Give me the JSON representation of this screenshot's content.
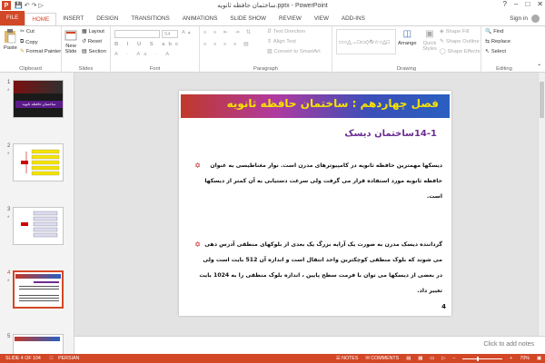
{
  "window": {
    "title": "ساختمان حافظه ثانویه.pptx - PowerPoint",
    "app_icon": "P",
    "minimize": "–",
    "maximize": "□",
    "close": "✕",
    "help": "?"
  },
  "quick_access": [
    "save-icon",
    "undo-icon",
    "redo-icon",
    "start-icon"
  ],
  "tabs": [
    "FILE",
    "HOME",
    "INSERT",
    "DESIGN",
    "TRANSITIONS",
    "ANIMATIONS",
    "SLIDE SHOW",
    "REVIEW",
    "VIEW",
    "ADD-INS"
  ],
  "active_tab": "HOME",
  "signin": "Sign in",
  "ribbon": {
    "clipboard": {
      "label": "Clipboard",
      "paste": "Paste",
      "cut": "Cut",
      "copy": "Copy",
      "format_painter": "Format Painter"
    },
    "slides": {
      "label": "Slides",
      "new_slide": "New",
      "new_slide2": "Slide",
      "layout": "Layout",
      "reset": "Reset",
      "section": "Section"
    },
    "font": {
      "label": "Font",
      "font_size": "54"
    },
    "paragraph": {
      "label": "Paragraph",
      "text_direction": "Text Direction",
      "align_text": "Align Text",
      "convert": "Convert to SmartArt"
    },
    "drawing": {
      "label": "Drawing",
      "arrange": "Arrange",
      "quick_styles": "Quick Styles",
      "shape_fill": "Shape Fill",
      "shape_outline": "Shape Outline",
      "shape_effects": "Shape Effects"
    },
    "editing": {
      "label": "Editing",
      "find": "Find",
      "replace": "Replace",
      "select": "Select"
    }
  },
  "thumbnails": [
    {
      "num": "1",
      "title": "ساختمان حافظه ثانویه"
    },
    {
      "num": "2"
    },
    {
      "num": "3"
    },
    {
      "num": "4"
    },
    {
      "num": "5"
    }
  ],
  "slide": {
    "title": "فصل چهاردهم : ساختمان حافظه ثانویه",
    "subtitle": "14-1ساختمان دیسک",
    "para1": "دیسکها مهمترین حافظه ثانویه در کامپیوترهای مدرن است. نوار مغناطیسی به عنوان حافظه ثانویه مورد استفاده قرار می گرفت ولی سرعت دستیابی به آن کمتر از دیسکها است.",
    "para2": "گرداننده دیسک مدرن به صورت یک آرایه بزرگ یک بعدی از بلوکهای منطقی آدرس دهی می شوند که بلوک منطقی کوچکترین واحد انتقال است و اندازه آن 512 بایت است ولی در بعضی از دیسکها می توان با فرمت سطح پایین ، اندازه بلوک منطقی را به 1024 بایت تغییر داد.",
    "bullet": "✡",
    "page_number": "4"
  },
  "notes_hint": "Click to add notes",
  "status": {
    "slide_info": "SLIDE 4 OF 104",
    "language": "PERSIAN",
    "notes": "NOTES",
    "comments": "COMMENTS",
    "zoom": "70%"
  },
  "zoom_level": 0.7,
  "colors": {
    "accent": "#d24726",
    "title_text": "#f5e300",
    "subtitle": "#6b2c91",
    "bullet": "#cc0000"
  }
}
